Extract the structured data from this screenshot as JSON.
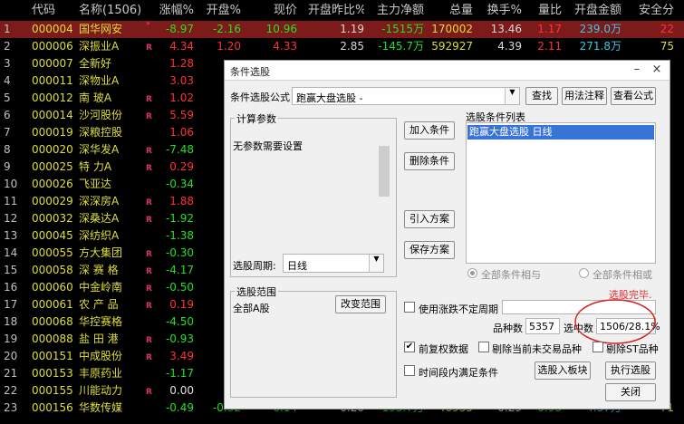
{
  "table": {
    "headers": {
      "idx": "",
      "code": "代码",
      "name": "名称(1506)",
      "chg": "涨幅%",
      "open": "开盘%",
      "price": "现价",
      "ratio": "开盘昨比%",
      "flow": "主力净额",
      "vol": "总量",
      "turn": "换手%",
      "qr": "量比",
      "amt": "开盘金额",
      "safe": "安全分"
    },
    "rows": [
      {
        "idx": "1",
        "code": "000004",
        "name": "国华网安",
        "mark": "*",
        "chg": "-8.97",
        "open": "-2.16",
        "price": "10.96",
        "ratio": "1.19",
        "flow": "-1515万",
        "vol": "170002",
        "turn": "13.46",
        "qr": "1.17",
        "amt": "239.0万",
        "safe": "22"
      },
      {
        "idx": "2",
        "code": "000006",
        "name": "深振业A",
        "mark": "R",
        "chg": "4.34",
        "open": "1.20",
        "price": "4.33",
        "ratio": "2.85",
        "flow": "-145.7万",
        "vol": "592927",
        "turn": "4.39",
        "qr": "2.11",
        "amt": "271.8万",
        "safe": "75"
      },
      {
        "idx": "3",
        "code": "000007",
        "name": "全新好",
        "mark": "",
        "chg": "1.28",
        "open": "",
        "price": "",
        "ratio": "",
        "flow": "",
        "vol": "",
        "turn": "",
        "qr": "",
        "amt": "",
        "safe": ""
      },
      {
        "idx": "4",
        "code": "000011",
        "name": "深物业A",
        "mark": "",
        "chg": "3.03",
        "open": "",
        "price": "",
        "ratio": "",
        "flow": "",
        "vol": "",
        "turn": "",
        "qr": "",
        "amt": "",
        "safe": ""
      },
      {
        "idx": "5",
        "code": "000012",
        "name": "南 玻A",
        "mark": "R",
        "chg": "1.02",
        "open": "",
        "price": "",
        "ratio": "",
        "flow": "",
        "vol": "",
        "turn": "",
        "qr": "",
        "amt": "",
        "safe": ""
      },
      {
        "idx": "6",
        "code": "000014",
        "name": "沙河股份",
        "mark": "R",
        "chg": "5.59",
        "open": "",
        "price": "",
        "ratio": "",
        "flow": "",
        "vol": "",
        "turn": "",
        "qr": "",
        "amt": "",
        "safe": ""
      },
      {
        "idx": "7",
        "code": "000019",
        "name": "深粮控股",
        "mark": "",
        "chg": "1.06",
        "open": "",
        "price": "",
        "ratio": "",
        "flow": "",
        "vol": "",
        "turn": "",
        "qr": "",
        "amt": "",
        "safe": ""
      },
      {
        "idx": "8",
        "code": "000020",
        "name": "深华发A",
        "mark": "R",
        "chg": "-7.48",
        "open": "",
        "price": "",
        "ratio": "",
        "flow": "",
        "vol": "",
        "turn": "",
        "qr": "",
        "amt": "",
        "safe": ""
      },
      {
        "idx": "9",
        "code": "000025",
        "name": "特 力A",
        "mark": "R",
        "chg": "0.29",
        "open": "",
        "price": "",
        "ratio": "",
        "flow": "",
        "vol": "",
        "turn": "",
        "qr": "",
        "amt": "",
        "safe": ""
      },
      {
        "idx": "10",
        "code": "000026",
        "name": "飞亚达",
        "mark": "",
        "chg": "-0.34",
        "open": "",
        "price": "",
        "ratio": "",
        "flow": "",
        "vol": "",
        "turn": "",
        "qr": "",
        "amt": "",
        "safe": ""
      },
      {
        "idx": "11",
        "code": "000029",
        "name": "深深房A",
        "mark": "R",
        "chg": "1.88",
        "open": "",
        "price": "",
        "ratio": "",
        "flow": "",
        "vol": "",
        "turn": "",
        "qr": "",
        "amt": "",
        "safe": ""
      },
      {
        "idx": "12",
        "code": "000032",
        "name": "深桑达A",
        "mark": "R",
        "chg": "-1.92",
        "open": "",
        "price": "",
        "ratio": "",
        "flow": "",
        "vol": "",
        "turn": "",
        "qr": "",
        "amt": "",
        "safe": ""
      },
      {
        "idx": "13",
        "code": "000045",
        "name": "深纺织A",
        "mark": "",
        "chg": "-1.38",
        "open": "",
        "price": "",
        "ratio": "",
        "flow": "",
        "vol": "",
        "turn": "",
        "qr": "",
        "amt": "",
        "safe": ""
      },
      {
        "idx": "14",
        "code": "000055",
        "name": "方大集团",
        "mark": "R",
        "chg": "-0.30",
        "open": "",
        "price": "",
        "ratio": "",
        "flow": "",
        "vol": "",
        "turn": "",
        "qr": "",
        "amt": "",
        "safe": ""
      },
      {
        "idx": "15",
        "code": "000058",
        "name": "深 赛 格",
        "mark": "R",
        "chg": "-4.17",
        "open": "",
        "price": "",
        "ratio": "",
        "flow": "",
        "vol": "",
        "turn": "",
        "qr": "",
        "amt": "",
        "safe": ""
      },
      {
        "idx": "16",
        "code": "000060",
        "name": "中金岭南",
        "mark": "R",
        "chg": "-0.50",
        "open": "",
        "price": "",
        "ratio": "",
        "flow": "",
        "vol": "",
        "turn": "",
        "qr": "",
        "amt": "",
        "safe": ""
      },
      {
        "idx": "17",
        "code": "000061",
        "name": "农 产 品",
        "mark": "R",
        "chg": "0.19",
        "open": "",
        "price": "",
        "ratio": "",
        "flow": "",
        "vol": "",
        "turn": "",
        "qr": "",
        "amt": "",
        "safe": ""
      },
      {
        "idx": "18",
        "code": "000068",
        "name": "华控赛格",
        "mark": "",
        "chg": "-4.50",
        "open": "",
        "price": "",
        "ratio": "",
        "flow": "",
        "vol": "",
        "turn": "",
        "qr": "",
        "amt": "",
        "safe": ""
      },
      {
        "idx": "19",
        "code": "000088",
        "name": "盐 田 港",
        "mark": "R",
        "chg": "-0.93",
        "open": "",
        "price": "",
        "ratio": "",
        "flow": "",
        "vol": "",
        "turn": "",
        "qr": "",
        "amt": "",
        "safe": ""
      },
      {
        "idx": "20",
        "code": "000151",
        "name": "中成股份",
        "mark": "R",
        "chg": "3.49",
        "open": "",
        "price": "",
        "ratio": "",
        "flow": "",
        "vol": "",
        "turn": "",
        "qr": "",
        "amt": "",
        "safe": ""
      },
      {
        "idx": "21",
        "code": "000153",
        "name": "丰原药业",
        "mark": "",
        "chg": "-1.17",
        "open": "",
        "price": "",
        "ratio": "",
        "flow": "",
        "vol": "",
        "turn": "",
        "qr": "",
        "amt": "",
        "safe": ""
      },
      {
        "idx": "22",
        "code": "000155",
        "name": "川能动力",
        "mark": "R",
        "chg": "0.00",
        "open": "",
        "price": "",
        "ratio": "",
        "flow": "",
        "vol": "",
        "turn": "",
        "qr": "",
        "amt": "",
        "safe": ""
      },
      {
        "idx": "23",
        "code": "000156",
        "name": "华数传媒",
        "mark": "",
        "chg": "-0.49",
        "open": "-0.32",
        "price": "6.14",
        "ratio": "0.20",
        "flow": "-195.7万",
        "vol": "46935",
        "turn": "0.29",
        "qr": "0.93",
        "amt": "4.37万",
        "safe": "71"
      }
    ]
  },
  "dialog": {
    "title": "条件选股",
    "formula_label": "条件选股公式",
    "formula_value": "跑赢大盘选股 -",
    "btn_find": "查找",
    "btn_usage": "用法注释",
    "btn_view": "查看公式",
    "params_group": "计算参数",
    "params_text": "无参数需要设置",
    "period_label": "选股周期:",
    "period_value": "日线",
    "btn_add": "加入条件",
    "btn_delete": "删除条件",
    "btn_import": "引入方案",
    "btn_save": "保存方案",
    "list_group": "选股条件列表",
    "list_items": [
      "跑赢大盘选股  日线"
    ],
    "radio_and": "全部条件相与",
    "radio_or": "全部条件相或",
    "scope_group": "选股范围",
    "scope_value": "全部A股",
    "btn_change_scope": "改变范围",
    "status_text": "选股完毕.",
    "chk_variable_period": "使用涨跌不定周期",
    "count_label": "品种数",
    "count_value": "5357",
    "selected_label": "选中数",
    "selected_value": "1506/28.1%",
    "chk_adjust": "前复权数据",
    "chk_adjust_checked": true,
    "chk_exclude_untraded": "剔除当前未交易品种",
    "chk_exclude_st": "剔除ST品种",
    "chk_time_range": "时间段内满足条件",
    "btn_to_block": "选股入板块",
    "btn_execute": "执行选股",
    "btn_close": "关闭",
    "colors": {
      "highlight_circle": "#d42020",
      "status_text": "#e03030",
      "list_selection": "#3873d6"
    }
  }
}
